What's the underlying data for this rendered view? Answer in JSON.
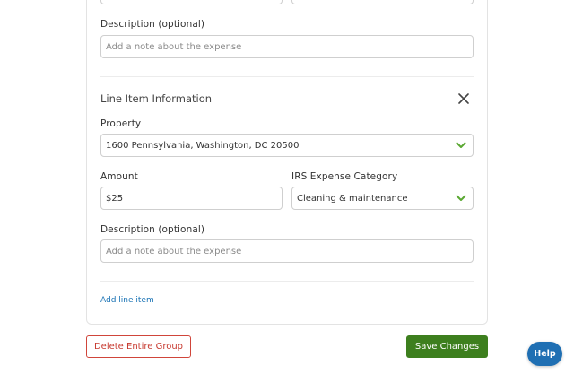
{
  "form": {
    "description_top": {
      "label": "Description (optional)",
      "placeholder": "Add a note about the expense"
    },
    "line_item": {
      "title": "Line Item Information",
      "close_icon": "close-icon",
      "property": {
        "label": "Property",
        "value": "1600 Pennsylvania, Washington, DC 20500",
        "icon": "chevron-down-icon"
      },
      "amount": {
        "label": "Amount",
        "value": "$25"
      },
      "irs_category": {
        "label": "IRS Expense Category",
        "value": "Cleaning & maintenance",
        "icon": "chevron-down-icon"
      },
      "description": {
        "label": "Description (optional)",
        "placeholder": "Add a note about the expense"
      }
    },
    "add_line_item_label": "Add line item"
  },
  "actions": {
    "delete_label": "Delete Entire Group",
    "save_label": "Save Changes",
    "help_label": "Help"
  },
  "colors": {
    "chevron": "#5aa832",
    "save_bg": "#3d7f1e",
    "delete": "#c7392f",
    "link": "#1a73b5",
    "help_bg": "#1f6fb3"
  }
}
